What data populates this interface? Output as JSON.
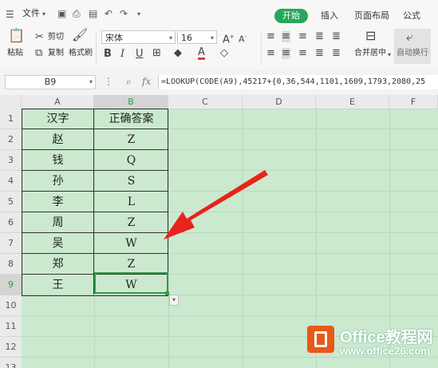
{
  "menu": {
    "file_label": "文件",
    "tabs": [
      {
        "label": "开始",
        "active": true
      },
      {
        "label": "插入"
      },
      {
        "label": "页面布局"
      },
      {
        "label": "公式"
      }
    ]
  },
  "ribbon": {
    "paste": "粘贴",
    "cut": "剪切",
    "copy": "复制",
    "format_painter": "格式刷",
    "font_name": "宋体",
    "font_size": "16",
    "merge_center": "合并居中",
    "wrap_text": "自动换行"
  },
  "formula_bar": {
    "name_box": "B9",
    "fx": "fx",
    "formula": "=LOOKUP(CODE(A9),45217+{0,36,544,1101,1609,1793,2080,25"
  },
  "sheet": {
    "columns": [
      "A",
      "B",
      "C",
      "D",
      "E",
      "F"
    ],
    "rows": [
      "1",
      "2",
      "3",
      "4",
      "5",
      "6",
      "7",
      "8",
      "9",
      "10",
      "11",
      "12",
      "13"
    ],
    "header": [
      "汉字",
      "正确答案"
    ],
    "data": [
      [
        "赵",
        "Z"
      ],
      [
        "钱",
        "Q"
      ],
      [
        "孙",
        "S"
      ],
      [
        "李",
        "L"
      ],
      [
        "周",
        "Z"
      ],
      [
        "吴",
        "W"
      ],
      [
        "郑",
        "Z"
      ],
      [
        "王",
        "W"
      ]
    ],
    "selected_cell": "B9"
  },
  "watermark": {
    "title": "Office教程网",
    "url": "www.office26.com"
  },
  "colors": {
    "accent": "#27a65a",
    "sheet_bg": "#cbe9cf",
    "arrow": "#e8231a",
    "logo": "#e8581a"
  }
}
